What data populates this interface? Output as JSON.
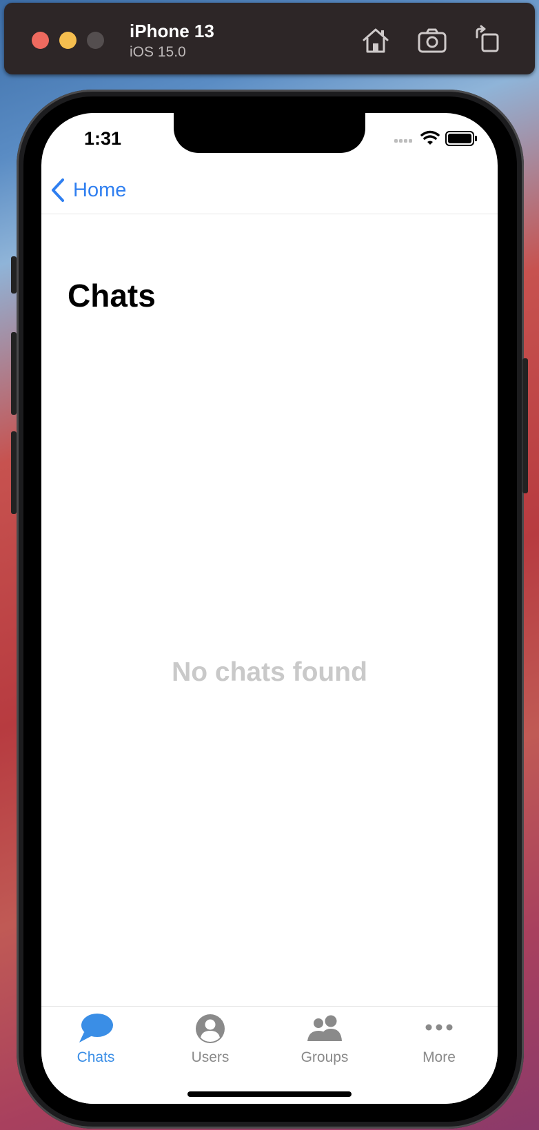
{
  "simulator": {
    "device_name": "iPhone 13",
    "os_version": "iOS 15.0",
    "buttons": [
      "home-icon",
      "screenshot-icon",
      "rotate-icon"
    ]
  },
  "status_bar": {
    "time": "1:31"
  },
  "nav": {
    "back_label": "Home"
  },
  "page": {
    "title": "Chats",
    "empty_message": "No chats found"
  },
  "tabs": [
    {
      "label": "Chats",
      "icon": "chat-bubble-icon",
      "active": true
    },
    {
      "label": "Users",
      "icon": "user-icon",
      "active": false
    },
    {
      "label": "Groups",
      "icon": "group-icon",
      "active": false
    },
    {
      "label": "More",
      "icon": "more-icon",
      "active": false
    }
  ],
  "colors": {
    "accent": "#3a8ee6",
    "back_link": "#2f7ff0",
    "inactive_tab": "#8a8a8a",
    "empty_text": "#c9c9c9"
  }
}
